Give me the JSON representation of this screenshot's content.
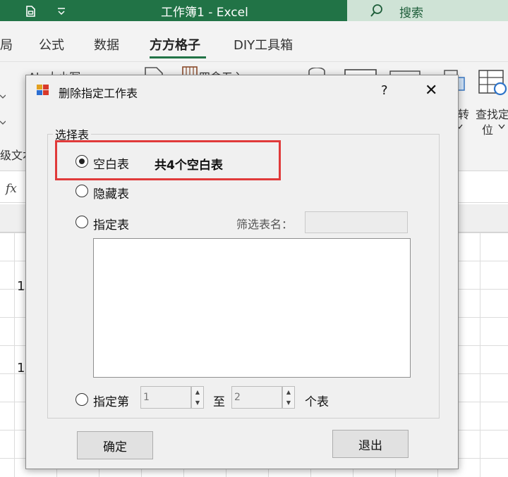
{
  "window": {
    "title": "工作簿1  -  Excel",
    "search_label": "搜索"
  },
  "ribbon_tabs": [
    {
      "label": "局"
    },
    {
      "label": "公式"
    },
    {
      "label": "数据"
    },
    {
      "label": "方方格子",
      "active": true
    },
    {
      "label": "DIY工具箱"
    }
  ],
  "ribbon_fragments": {
    "font_size_label": "Ab 大小写",
    "round_label": "四舍五入",
    "rotate_label": "转",
    "find_label": "查找定",
    "position_label": "位",
    "text_label": "级文本"
  },
  "grid": {
    "row_values": [
      "1",
      "1"
    ]
  },
  "dialog": {
    "title": "删除指定工作表",
    "help_label": "?",
    "close_label": "✕",
    "group_label": "选择表",
    "options": {
      "blank": {
        "label": "空白表",
        "checked": true
      },
      "hidden": {
        "label": "隐藏表",
        "checked": false
      },
      "specified": {
        "label": "指定表",
        "checked": false
      },
      "range": {
        "label": "指定第",
        "checked": false
      }
    },
    "blank_count_text": "共4个空白表",
    "filter_label": "筛选表名：",
    "filter_value": "",
    "range_from": "1",
    "range_to_label": "至",
    "range_to": "2",
    "range_suffix": "个表",
    "ok_label": "确定",
    "exit_label": "退出"
  },
  "colors": {
    "excel_green": "#217346",
    "highlight_red": "#e03a3a"
  }
}
